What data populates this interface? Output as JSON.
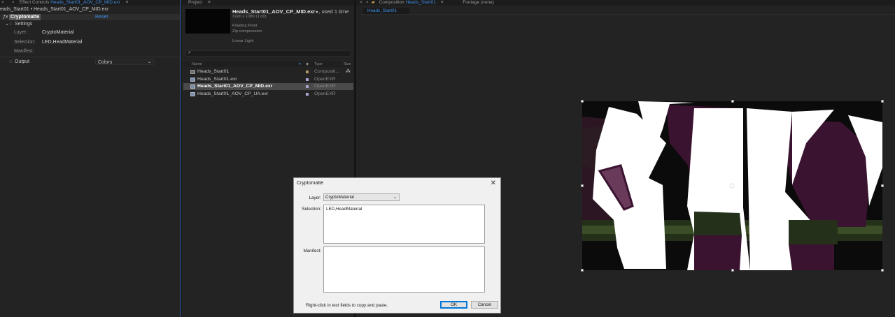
{
  "effect_controls": {
    "tab_title": "Effect Controls",
    "tab_file": "Heads_Start01_AOV_CP_MID.exr",
    "breadcrumb": "eads_Start01 • Heads_Start01_AOV_CP_MID.exr",
    "effect_name": "Cryptomatte",
    "reset_label": "Reset",
    "settings_label": "Settings",
    "layer_label": "Layer:",
    "layer_value": "CryptoMaterial",
    "selection_label": "Selection:",
    "selection_value": "LED,HeadMaterial",
    "manifest_label": "Manifest:",
    "output_label": "Output",
    "output_value": "Colors"
  },
  "project": {
    "tab_title": "Project",
    "preview_name": "Heads_Start01_AOV_CP_MID.exr",
    "preview_used": ", used 1 time",
    "preview_dims": "1920 x 1080 (1.00)",
    "preview_depth": "Floating Point",
    "preview_compression": "Zip compression",
    "preview_color": "Linear Light",
    "search_placeholder": "",
    "col_name": "Name",
    "col_type": "Type",
    "col_size": "Size",
    "items": [
      {
        "name": "Heads_Start01",
        "type": "Compositi…",
        "swatch": "#b89a6a",
        "kind": "comp"
      },
      {
        "name": "Heads_Start01.exr",
        "type": "OpenEXR",
        "swatch": "#a9a6d0",
        "kind": "footage"
      },
      {
        "name": "Heads_Start01_AOV_CP_MID.exr",
        "type": "OpenEXR",
        "swatch": "#a9a6d0",
        "kind": "footage",
        "selected": true
      },
      {
        "name": "Heads_Start01_AOV_CP_UA.exr",
        "type": "OpenEXR",
        "swatch": "#a9a6d0",
        "kind": "footage"
      }
    ]
  },
  "composition": {
    "tab_title": "Composition",
    "tab_comp": "Heads_Start01",
    "footage_tab": "Footage (none)",
    "sub_tab": "Heads_Start01"
  },
  "dialog": {
    "title": "Cryptomatte",
    "close_glyph": "✕",
    "layer_label": "Layer:",
    "layer_value": "CryptoMaterial",
    "selection_label": "Selection:",
    "selection_value": "LED,HeadMaterial",
    "manifest_label": "Manifest:",
    "manifest_value": "",
    "hint": "Right-click in text fields to copy and paste.",
    "ok_label": "OK",
    "cancel_label": "Cancel"
  },
  "icons": {
    "dropdown": "chevron-down-icon",
    "search": "search-icon",
    "menu": "hamburger-icon"
  },
  "colors": {
    "accent": "#3f8ee8",
    "panel_bg": "#232323",
    "matte_purple": "#3c1430",
    "matte_olive": "#2a3a14"
  }
}
